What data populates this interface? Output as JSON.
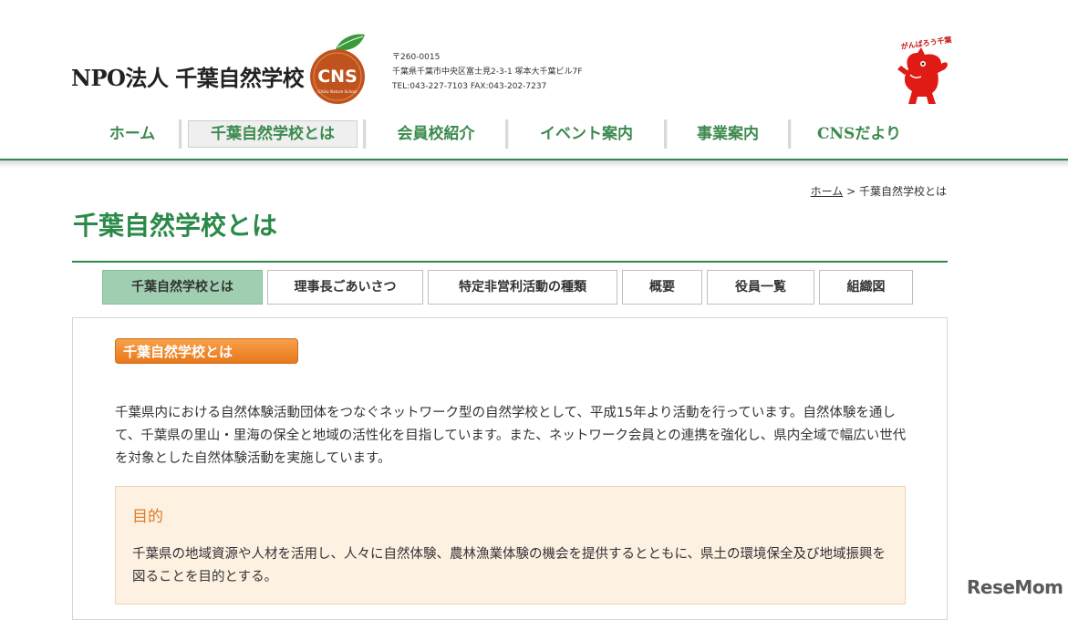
{
  "header": {
    "org_name": "NPO法人 千葉自然学校",
    "logo": {
      "text": "CNS",
      "subtext": "Chiba Nature School",
      "colors": {
        "leaf": "#3a9a3a",
        "circle": "#c0531d"
      }
    },
    "address": {
      "postal": "〒260-0015",
      "street": "千葉県千葉市中央区富士見2-3-1 塚本大千葉ビル7F",
      "contact": "TEL:043-227-7103 FAX:043-202-7237"
    },
    "mascot": {
      "caption": "がんばろう千葉",
      "icon": "chiba-kun-mascot"
    }
  },
  "nav": {
    "items": [
      {
        "label": "ホーム",
        "active": false
      },
      {
        "label": "千葉自然学校とは",
        "active": true
      },
      {
        "label": "会員校紹介",
        "active": false
      },
      {
        "label": "イベント案内",
        "active": false
      },
      {
        "label": "事業案内",
        "active": false
      },
      {
        "label": "CNSだより",
        "active": false
      }
    ]
  },
  "breadcrumb": {
    "home": "ホーム",
    "separator": " > ",
    "current": "千葉自然学校とは"
  },
  "page": {
    "title": "千葉自然学校とは"
  },
  "subtabs": {
    "items": [
      {
        "label": "千葉自然学校とは",
        "active": true
      },
      {
        "label": "理事長ごあいさつ",
        "active": false
      },
      {
        "label": "特定非営利活動の種類",
        "active": false
      },
      {
        "label": "概要",
        "active": false
      },
      {
        "label": "役員一覧",
        "active": false
      },
      {
        "label": "組織図",
        "active": false
      }
    ]
  },
  "content": {
    "section_heading": "千葉自然学校とは",
    "intro": "千葉県内における自然体験活動団体をつなぐネットワーク型の自然学校として、平成15年より活動を行っています。自然体験を通して、千葉県の里山・里海の保全と地域の活性化を目指しています。また、ネットワーク会員との連携を強化し、県内全域で幅広い世代を対象とした自然体験活動を実施しています。",
    "purpose": {
      "title": "目的",
      "text": "千葉県の地域資源や人材を活用し、人々に自然体験、農林漁業体験の機会を提供するとともに、県土の環境保全及び地域振興を図ることを目的とする。"
    }
  },
  "watermark": "ReseMom",
  "colors": {
    "brand_green": "#2b8a49",
    "nav_green": "#3c8a4e",
    "active_tab": "#9fcfb0",
    "orange": "#e8791c",
    "purpose_bg": "#fdf1e2"
  }
}
